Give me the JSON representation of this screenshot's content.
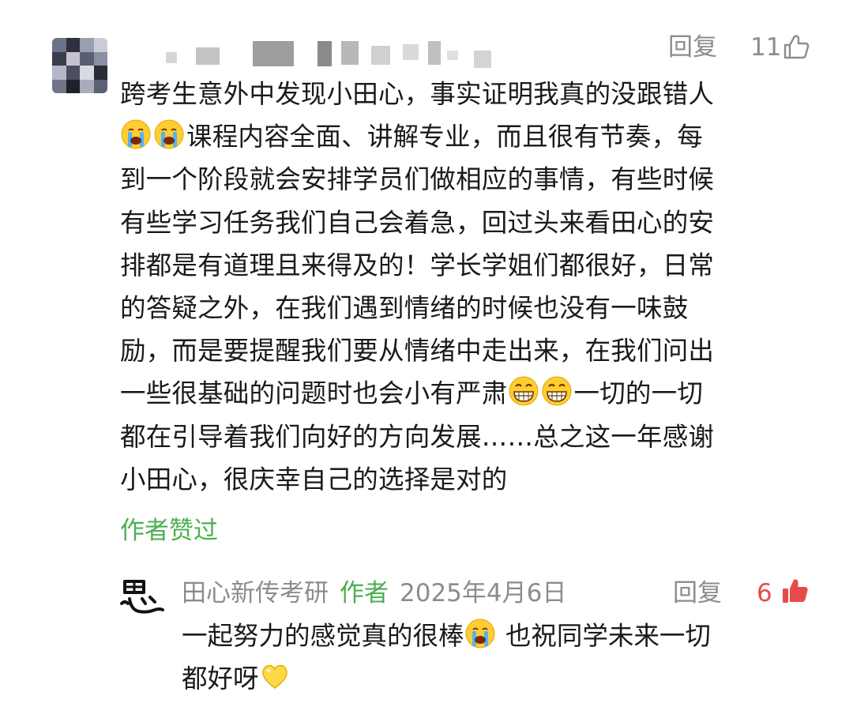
{
  "comment": {
    "avatar_icon": "pixelated-avatar",
    "username": "",
    "reply_label": "回复",
    "like_count": "11",
    "like_icon": "thumbs-up-outline-icon",
    "lines": [
      {
        "pre": "跨考生意外中发现小田心，事实证明我真的没跟错人",
        "emoji": "",
        "post": ""
      },
      {
        "pre": "",
        "emoji": "crying-face-x2",
        "post": "课程内容全面、讲解专业，而且很有节奏，每"
      },
      {
        "pre": "到一个阶段就会安排学员们做相应的事情，有些时候",
        "emoji": "",
        "post": ""
      },
      {
        "pre": "有些学习任务我们自己会着急，回过头来看田心的安",
        "emoji": "",
        "post": ""
      },
      {
        "pre": "排都是有道理且来得及的！学长学姐们都很好，日常",
        "emoji": "",
        "post": ""
      },
      {
        "pre": "的答疑之外，在我们遇到情绪的时候也没有一味鼓",
        "emoji": "",
        "post": ""
      },
      {
        "pre": "励，而是要提醒我们要从情绪中走出来，在我们问出",
        "emoji": "",
        "post": ""
      },
      {
        "pre": "一些很基础的问题时也会小有严肃",
        "emoji": "grinning-face-x2",
        "post": "一切的一切"
      },
      {
        "pre": "都在引导着我们向好的方向发展……总之这一年感谢",
        "emoji": "",
        "post": ""
      },
      {
        "pre": "小田心，很庆幸自己的选择是对的",
        "emoji": "",
        "post": ""
      }
    ],
    "author_liked": "作者赞过"
  },
  "reply": {
    "avatar_icon": "calligraphy-logo-icon",
    "name": "田心新传考研",
    "author_tag": "作者",
    "date": "2025年4月6日",
    "reply_label": "回复",
    "like_count": "6",
    "like_icon": "thumbs-up-filled-red-icon",
    "line1_pre": "一起努力的感觉真的很棒",
    "line1_emoji": "crying-face",
    "line1_post": " 也祝同学未来一切",
    "line2_pre": "都好呀",
    "line2_emoji": "yellow-heart",
    "colors": {
      "author_green": "#4caf50",
      "meta_gray": "#8c8c8c",
      "like_red": "#e64b4b"
    }
  }
}
